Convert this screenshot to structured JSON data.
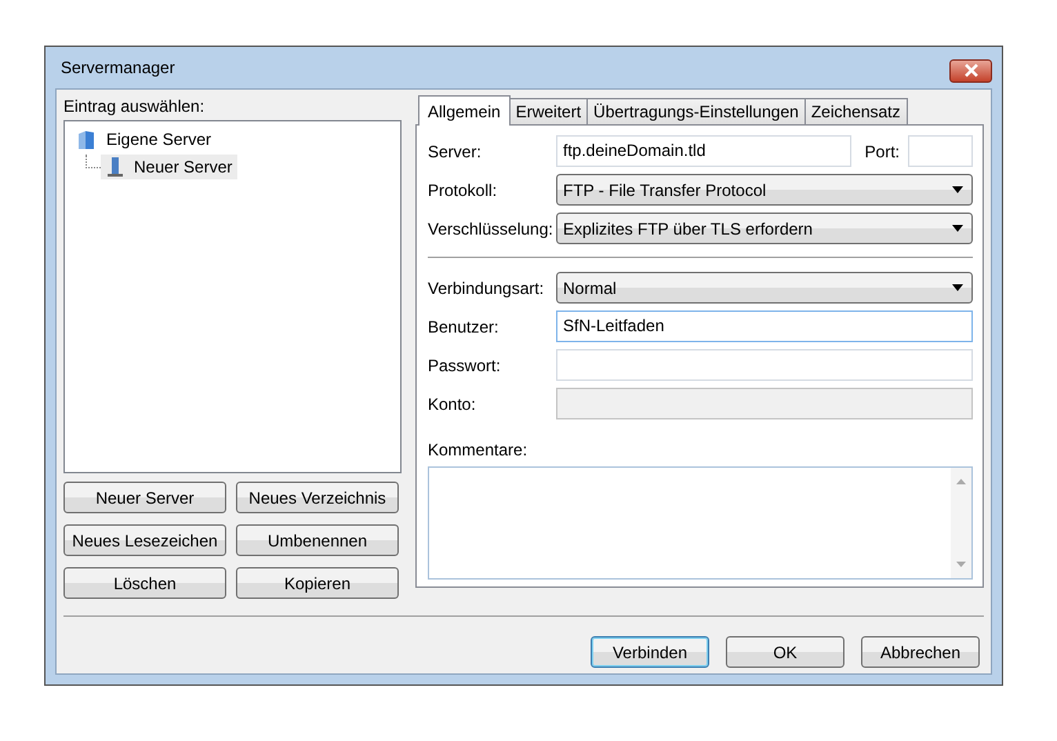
{
  "window": {
    "title": "Servermanager"
  },
  "entry_label": "Eintrag auswählen:",
  "tree": [
    {
      "label": "Eigene Server",
      "kind": "folder",
      "selected": false,
      "children": [
        {
          "label": "Neuer Server",
          "kind": "server",
          "selected": true
        }
      ]
    }
  ],
  "left_buttons": [
    "Neuer Server",
    "Neues Verzeichnis",
    "Neues Lesezeichen",
    "Umbenennen",
    "Löschen",
    "Kopieren"
  ],
  "tabs": [
    {
      "label": "Allgemein",
      "selected": true
    },
    {
      "label": "Erweitert",
      "selected": false
    },
    {
      "label": "Übertragungs-Einstellungen",
      "selected": false
    },
    {
      "label": "Zeichensatz",
      "selected": false
    }
  ],
  "connection_fields": [
    {
      "label": "Server:",
      "kind": "input",
      "value": "ftp.deineDomain.tld",
      "disabled": false,
      "extra": {
        "label": "Port:"
      }
    },
    {
      "label": "Protokoll:",
      "kind": "select",
      "value": "FTP - File Transfer Protocol",
      "disabled": false
    },
    {
      "label": "Verschlüsselung:",
      "kind": "select",
      "value": "Explizites FTP über TLS erfordern",
      "disabled": false
    }
  ],
  "login_fields": [
    {
      "label": "Verbindungsart:",
      "kind": "select",
      "value": "Normal",
      "disabled": false
    },
    {
      "label": "Benutzer:",
      "kind": "input",
      "value": "SfN-Leitfaden",
      "disabled": false
    },
    {
      "label": "Passwort:",
      "kind": "input",
      "disabled": false
    },
    {
      "label": "Konto:",
      "kind": "input",
      "disabled": true
    }
  ],
  "comments": {
    "label": "Kommentare:"
  },
  "dialog_buttons": [
    {
      "label": "Verbinden",
      "default": true
    },
    {
      "label": "OK",
      "default": false
    },
    {
      "label": "Abbrechen",
      "default": false
    }
  ]
}
